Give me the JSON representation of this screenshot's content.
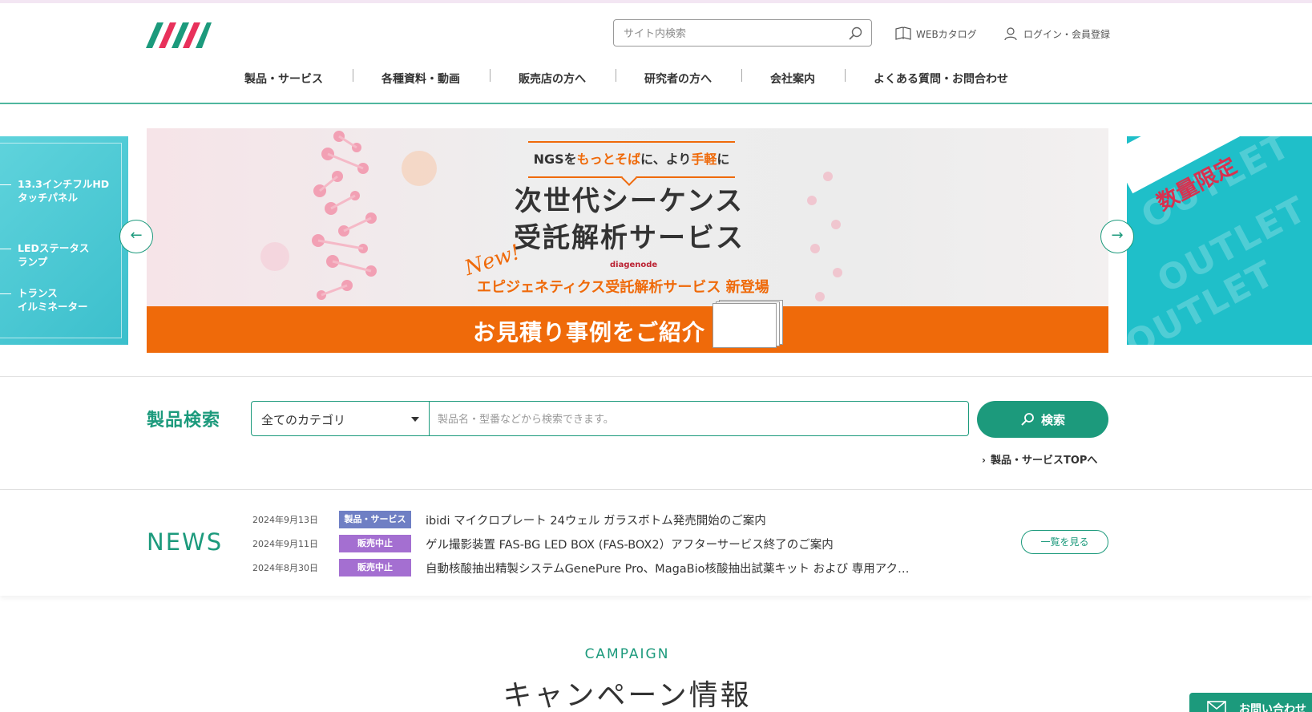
{
  "header": {
    "search_placeholder": "サイト内検索",
    "web_catalog": "WEBカタログ",
    "login": "ログイン・会員登録"
  },
  "gnav": [
    "製品・サービス",
    "各種資料・動画",
    "販売店の方へ",
    "研究者の方へ",
    "会社案内",
    "よくある質問・お問合わせ"
  ],
  "carousel": {
    "left_slide": [
      "13.3インチフルHD\nタッチパネル",
      "LEDステータス\nランプ",
      "トランス\nイルミネーター"
    ],
    "lead_parts": [
      "NGSを",
      "もっとそば",
      "に、より",
      "手軽",
      "に"
    ],
    "title_line1": "次世代シーケンス",
    "title_line2": "受託解析サービス",
    "new_label": "New!",
    "brand": "diagenode",
    "subtitle": "エピジェネティクス受託解析サービス 新登場",
    "band": "お見積り事例をご紹介",
    "right_banner": "数量限定",
    "right_bg_word": "OUTLET",
    "prev": "←",
    "next": "→"
  },
  "product_search": {
    "title": "製品検索",
    "category": "全てのカテゴリ",
    "placeholder": "製品名・型番などから検索できます。",
    "button": "検索",
    "top_link": "製品・サービスTOPへ"
  },
  "news": {
    "title": "NEWS",
    "more": "一覧を見る",
    "items": [
      {
        "date": "2024年9月13日",
        "tag": "製品・サービス",
        "tag_color": "#6f7fc4",
        "text": "ibidi マイクロプレート 24ウェル ガラスボトム発売開始のご案内"
      },
      {
        "date": "2024年9月11日",
        "tag": "販売中止",
        "tag_color": "#a46fd1",
        "text": "ゲル撮影装置 FAS-BG LED BOX (FAS-BOX2）アフターサービス終了のご案内"
      },
      {
        "date": "2024年8月30日",
        "tag": "販売中止",
        "tag_color": "#a46fd1",
        "text": "自動核酸抽出精製システムGenePure Pro、MagaBio核酸抽出試薬キット および 専用アク…"
      }
    ]
  },
  "campaign": {
    "en": "CAMPAIGN",
    "ja": "キャンペーン情報"
  },
  "floating": {
    "contact": "お問い合わせ"
  },
  "colors": {
    "brand_green": "#1c9a7c",
    "accent_orange": "#ef6a0a",
    "outlet_cyan": "#1fbfc9"
  }
}
